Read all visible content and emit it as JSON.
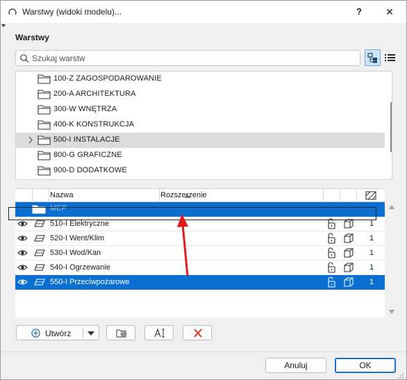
{
  "window": {
    "title": "Warstwy (widoki modelu)...",
    "help_label": "?",
    "close_label": "✕"
  },
  "section_title": "Warstwy",
  "search": {
    "placeholder": "Szukaj warstw"
  },
  "folders": [
    {
      "label": "100-Z ZAGOSPODAROWANIE",
      "highlighted": false,
      "expandable": false
    },
    {
      "label": "200-A ARCHITEKTURA",
      "highlighted": false,
      "expandable": false
    },
    {
      "label": "300-W WNĘTRZA",
      "highlighted": false,
      "expandable": false
    },
    {
      "label": "400-K KONSTRUKCJA",
      "highlighted": false,
      "expandable": false
    },
    {
      "label": "500-I INSTALACJE",
      "highlighted": true,
      "expandable": true
    },
    {
      "label": "800-G GRAFICZNE",
      "highlighted": false,
      "expandable": false
    },
    {
      "label": "900-D DODATKOWE",
      "highlighted": false,
      "expandable": false
    }
  ],
  "layer_table": {
    "columns": {
      "name": "Nazwa",
      "extension": "Rozszerzenie"
    },
    "group_row": {
      "name": "MEP"
    },
    "rows": [
      {
        "name": "510-I Elektryczne",
        "count": "1",
        "selected": false
      },
      {
        "name": "520-I Went/Klim",
        "count": "1",
        "selected": false
      },
      {
        "name": "530-I Wod/Kan",
        "count": "1",
        "selected": false
      },
      {
        "name": "540-I Ogrzewanie",
        "count": "1",
        "selected": false
      },
      {
        "name": "550-I Przeciwpożarowe",
        "count": "1",
        "selected": true
      }
    ]
  },
  "toolbar": {
    "create_label": "Utwórz"
  },
  "footer": {
    "cancel_label": "Anuluj",
    "ok_label": "OK"
  },
  "colors": {
    "selection": "#0a6fd0",
    "highlight": "#dcdcdc",
    "delete": "#e0301e",
    "annotation_arrow": "#e01b1b"
  }
}
